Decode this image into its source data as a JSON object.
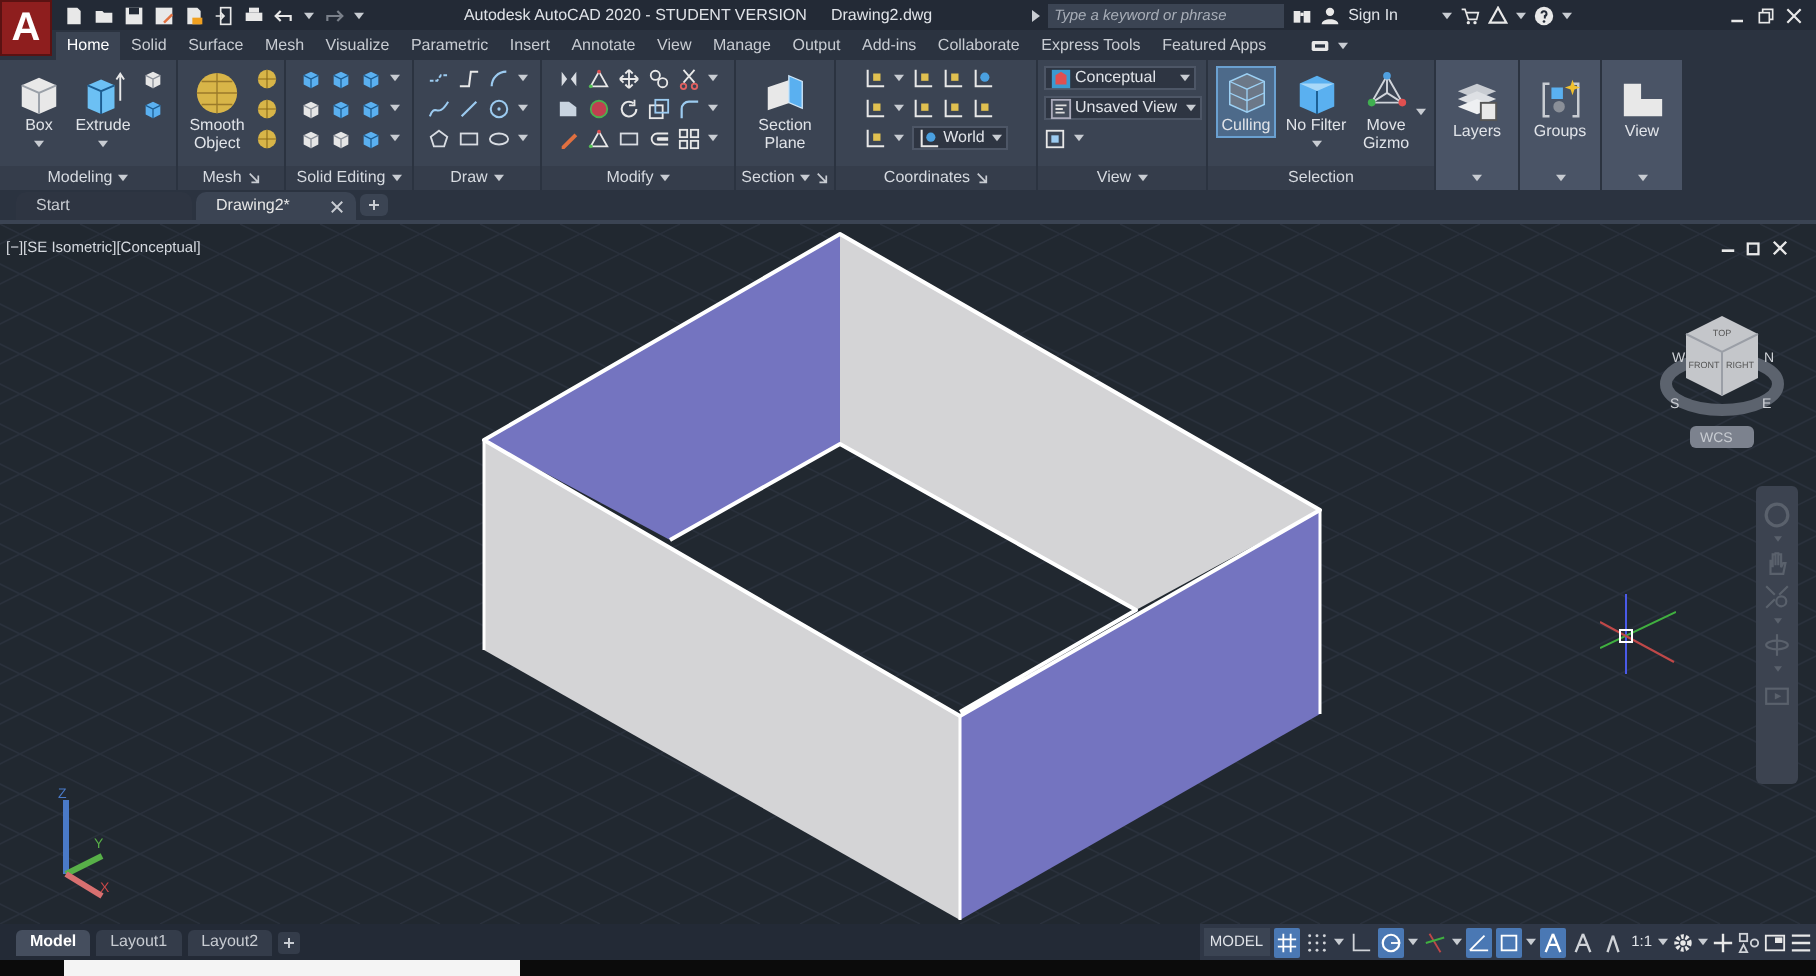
{
  "title_bar": {
    "app_letter": "A",
    "title": "Autodesk AutoCAD 2020 - STUDENT VERSION",
    "document": "Drawing2.dwg",
    "search": {
      "placeholder": "Type a keyword or phrase"
    },
    "sign_in": "Sign In"
  },
  "ribbon_tabs": [
    {
      "label": "Home",
      "selected": true
    },
    {
      "label": "Solid",
      "selected": false
    },
    {
      "label": "Surface",
      "selected": false
    },
    {
      "label": "Mesh",
      "selected": false
    },
    {
      "label": "Visualize",
      "selected": false
    },
    {
      "label": "Parametric",
      "selected": false
    },
    {
      "label": "Insert",
      "selected": false
    },
    {
      "label": "Annotate",
      "selected": false
    },
    {
      "label": "View",
      "selected": false
    },
    {
      "label": "Manage",
      "selected": false
    },
    {
      "label": "Output",
      "selected": false
    },
    {
      "label": "Add-ins",
      "selected": false
    },
    {
      "label": "Collaborate",
      "selected": false
    },
    {
      "label": "Express Tools",
      "selected": false
    },
    {
      "label": "Featured Apps",
      "selected": false
    }
  ],
  "panels": [
    {
      "kind": "panel",
      "title": "Modeling",
      "buttons": [
        {
          "label": "Box",
          "on": false
        },
        {
          "label": "Extrude",
          "on": false
        }
      ]
    },
    {
      "kind": "panel",
      "title": "Mesh",
      "buttons": [
        {
          "label": "Smooth Object",
          "on": false
        }
      ]
    },
    {
      "kind": "panel",
      "title": "Solid Editing"
    },
    {
      "kind": "panel",
      "title": "Draw"
    },
    {
      "kind": "panel",
      "title": "Modify"
    },
    {
      "kind": "panel",
      "title": "Section",
      "buttons": [
        {
          "label": "Section Plane",
          "on": false
        }
      ]
    },
    {
      "kind": "panel",
      "title": "Coordinates",
      "combos": [
        "World"
      ]
    },
    {
      "kind": "panel",
      "title": "View",
      "combos": [
        "Conceptual",
        "Unsaved View"
      ]
    },
    {
      "kind": "panel",
      "title": "Selection",
      "buttons": [
        {
          "label": "Culling",
          "on": true
        },
        {
          "label": "No Filter",
          "on": false
        },
        {
          "label": "Move Gizmo",
          "on": false
        }
      ]
    },
    {
      "kind": "collapsed",
      "buttons": [
        {
          "label": "Layers",
          "on": false
        }
      ]
    },
    {
      "kind": "collapsed",
      "buttons": [
        {
          "label": "Groups",
          "on": false
        }
      ]
    },
    {
      "kind": "collapsed",
      "buttons": [
        {
          "label": "View",
          "on": false
        }
      ]
    }
  ],
  "file_tabs": [
    {
      "label": "Start",
      "selected": false
    },
    {
      "label": "Drawing2*",
      "selected": true
    }
  ],
  "viewport": {
    "label": "[−][SE Isometric][Conceptual]",
    "viewcube": {
      "faces": [
        "TOP",
        "FRONT",
        "RIGHT"
      ],
      "compass": [
        "W",
        "N",
        "S",
        "E"
      ],
      "wcs": "WCS"
    },
    "ucs_labels": [
      "Z",
      "Y",
      "X"
    ]
  },
  "layout_tabs": [
    {
      "label": "Model",
      "selected": true
    },
    {
      "label": "Layout1",
      "selected": false
    },
    {
      "label": "Layout2",
      "selected": false
    }
  ],
  "status_bar": {
    "model": "MODEL",
    "scale": "1:1",
    "toggles": [
      {
        "on": true
      },
      {
        "on": false
      },
      {
        "on": false
      },
      {
        "on": true
      },
      {
        "on": false
      },
      {
        "on": true
      },
      {
        "on": true
      },
      {
        "on": true
      },
      {
        "on": false
      },
      {
        "on": false
      }
    ]
  }
}
